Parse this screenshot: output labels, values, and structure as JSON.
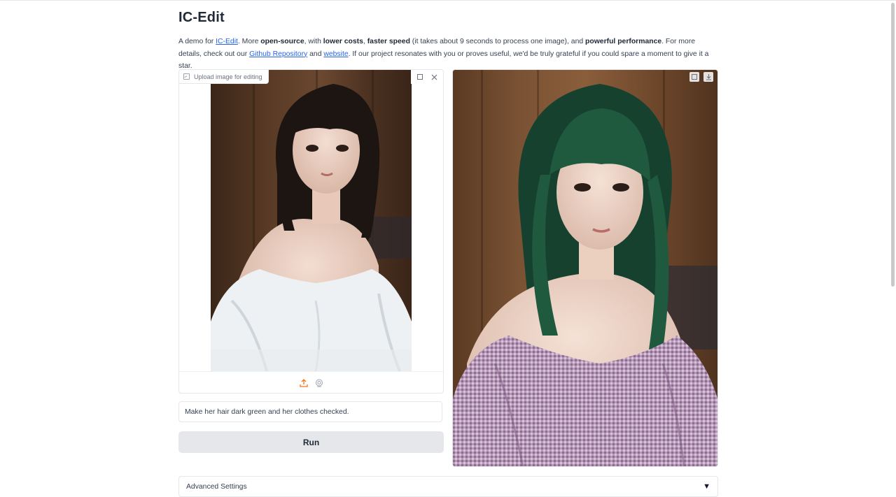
{
  "page": {
    "title": "IC-Edit",
    "description": {
      "t1": "A demo for ",
      "link_icedit": "IC-Edit",
      "t2": ". More ",
      "b_open": "open-source",
      "t3": ", with ",
      "b_lower": "lower costs",
      "t4": ", ",
      "b_faster": "faster speed",
      "t5": " (it takes about 9 seconds to process one image), and ",
      "b_powerful": "powerful performance",
      "t6": ". For more details, check out our ",
      "link_github": "Github Repository",
      "t7": " and ",
      "link_website": "website",
      "t8": ". If our project resonates with you or proves useful, we'd be truly grateful if you could spare a moment to give it a star."
    }
  },
  "input_panel": {
    "label": "Upload image for editing",
    "icons": [
      "fullscreen-icon",
      "close-icon",
      "upload-icon",
      "webcam-icon"
    ]
  },
  "prompt": {
    "value": "Make her hair dark green and her clothes checked."
  },
  "run": {
    "label": "Run"
  },
  "output_panel": {
    "icons": [
      "fullscreen-icon",
      "download-icon"
    ]
  },
  "advanced": {
    "label": "Advanced Settings",
    "toggle": "▼"
  },
  "colors": {
    "accent_orange": "#f97316",
    "link": "#2563eb",
    "button_bg": "#e5e7eb"
  }
}
